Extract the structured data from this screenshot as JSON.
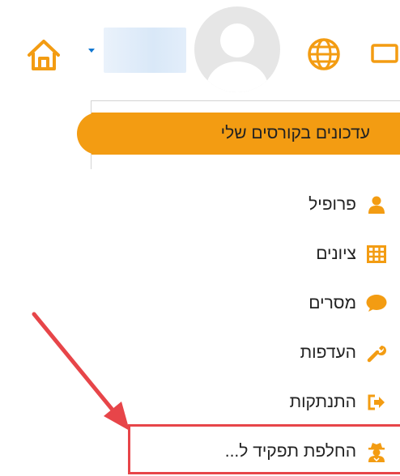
{
  "header": {
    "home_icon": "home-icon",
    "globe_icon": "globe-icon",
    "chat_icon": "chat-icon",
    "accent_color": "#f39c12"
  },
  "dropdown": {
    "highlighted_item": "עדכונים בקורסים שלי"
  },
  "menu": {
    "items": [
      {
        "label": "פרופיל",
        "icon": "user-icon"
      },
      {
        "label": "ציונים",
        "icon": "table-grid-icon"
      },
      {
        "label": "מסרים",
        "icon": "speech-bubble-icon"
      },
      {
        "label": "העדפות",
        "icon": "wrench-icon"
      },
      {
        "label": "התנתקות",
        "icon": "sign-out-icon"
      },
      {
        "label": "החלפת תפקיד ל...",
        "icon": "user-secret-icon"
      }
    ]
  },
  "annotation": {
    "arrow_color": "#e74549"
  }
}
